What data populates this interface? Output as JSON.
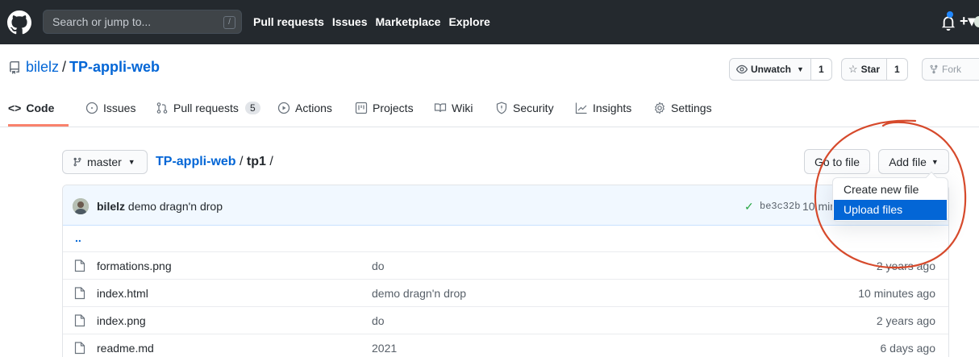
{
  "header": {
    "search_placeholder": "Search or jump to...",
    "search_hotkey": "/",
    "nav": [
      "Pull requests",
      "Issues",
      "Marketplace",
      "Explore"
    ],
    "plus": "+▾"
  },
  "repo": {
    "owner": "bilelz",
    "separator": "/",
    "name": "TP-appli-web",
    "watch_label": "Unwatch",
    "watch_count": "1",
    "star_label": "Star",
    "star_count": "1",
    "fork_label": "Fork"
  },
  "tabs": {
    "code": "Code",
    "issues": "Issues",
    "pulls": "Pull requests",
    "pulls_count": "5",
    "actions": "Actions",
    "projects": "Projects",
    "wiki": "Wiki",
    "security": "Security",
    "insights": "Insights",
    "settings": "Settings"
  },
  "toolbar": {
    "branch": "master",
    "breadcrumb_root": "TP-appli-web",
    "breadcrumb_sep": " / ",
    "breadcrumb_current": "tp1",
    "breadcrumb_trailing": " /",
    "go_to_file": "Go to file",
    "add_file": "Add file"
  },
  "commit": {
    "author": "bilelz",
    "message": "demo dragn'n drop",
    "sha": "be3c32b",
    "time": "10 min"
  },
  "files": {
    "parent": "..",
    "rows": [
      {
        "name": "formations.png",
        "message": "do",
        "age": "2 years ago"
      },
      {
        "name": "index.html",
        "message": "demo dragn'n drop",
        "age": "10 minutes ago"
      },
      {
        "name": "index.png",
        "message": "do",
        "age": "2 years ago"
      },
      {
        "name": "readme.md",
        "message": "2021",
        "age": "6 days ago"
      }
    ]
  },
  "dropdown": {
    "create": "Create new file",
    "upload": "Upload files"
  },
  "colors": {
    "header_bg": "#24292e",
    "link": "#0366d6",
    "tab_active": "#f9826c",
    "highlight": "#0366d6",
    "annotation_circle": "#d64a2c"
  }
}
